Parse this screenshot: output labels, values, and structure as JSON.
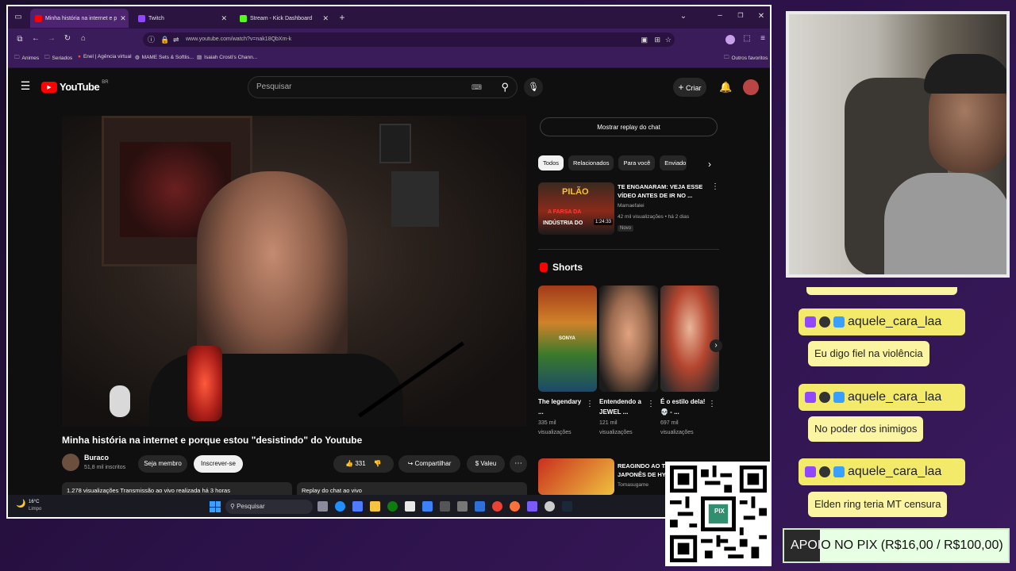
{
  "browser": {
    "tabs": [
      {
        "title": "Minha história na internet e p",
        "active": true,
        "color": "#ff0000"
      },
      {
        "title": "Twitch",
        "active": false,
        "color": "#9146ff"
      },
      {
        "title": "Stream - Kick Dashboard",
        "active": false,
        "color": "#53fc18"
      }
    ],
    "url": "www.youtube.com/watch?v=nak18QbXm-k",
    "bookmarks": [
      "Animes",
      "Seriados",
      "Enel | Agência virtual",
      "MAME Sets & Softlis...",
      "Isaiah Crosti's Chann..."
    ],
    "other_bookmarks": "Outros favoritos"
  },
  "youtube": {
    "logo": "YouTube",
    "country": "BR",
    "search_placeholder": "Pesquisar",
    "create_label": "Criar",
    "video_title": "Minha história na internet e porque estou \"desistindo\" do Youtube",
    "channel_name": "Buraco",
    "subscribers": "51,8 mil inscritos",
    "join_label": "Seja membro",
    "subscribe_label": "Inscrever-se",
    "likes": "331",
    "share_label": "Compartilhar",
    "thanks_label": "Valeu",
    "description_stats": "1.278 visualizações  Transmissão ao vivo realizada há 3 horas",
    "chat_replay_label": "Replay do chat ao vivo",
    "show_chat_replay": "Mostrar replay do chat",
    "chips": [
      "Todos",
      "Relacionados",
      "Para você",
      "Enviado"
    ],
    "recommended": [
      {
        "title": "TE ENGANARAM: VEJA ESSE VÍDEO ANTES DE IR NO ...",
        "channel": "Mamaefalei",
        "meta": "42 mil visualizações • há 2 dias",
        "badge": "Novo",
        "duration": "1:24:33",
        "thumb_text_1": "PILÃO",
        "thumb_text_2": "A FARSA DA",
        "thumb_text_3": "INDÚSTRIA DO"
      }
    ],
    "shorts_heading": "Shorts",
    "shorts": [
      {
        "title": "The legendary ...",
        "views": "335 mil visualizações",
        "thumb_label": "SONYA"
      },
      {
        "title": "Entendendo a JEWEL ...",
        "views": "121 mil visualizações",
        "thumb_label": ""
      },
      {
        "title": "É o estilo dela! 💀 - ...",
        "views": "697 mil visualizações",
        "thumb_label": ""
      }
    ],
    "next_video": {
      "title": "REAGINDO AO TORNEIO JAPONÊS DE HYP...",
      "channel": "Tomasugame"
    }
  },
  "taskbar": {
    "weather_temp": "16°C",
    "weather_desc": "Limpo",
    "search_label": "Pesquisar"
  },
  "stream_overlay": {
    "chat": [
      {
        "user": "aquele_cara_laa",
        "message": "Eu digo fiel na violência"
      },
      {
        "user": "aquele_cara_laa",
        "message": "No poder dos inimigos"
      },
      {
        "user": "aquele_cara_laa",
        "message": "Elden ring teria MT censura"
      }
    ],
    "pix_banner": "APOIO NO PIX (R$16,00 / R$100,00)",
    "qr_label": "PIX",
    "colors": {
      "chat_user_bg": "#f3ea6a",
      "chat_msg_bg": "#fbf4a0",
      "pix_bg": "#e7ffe2",
      "pix_progress": "#2a2a2a"
    }
  }
}
